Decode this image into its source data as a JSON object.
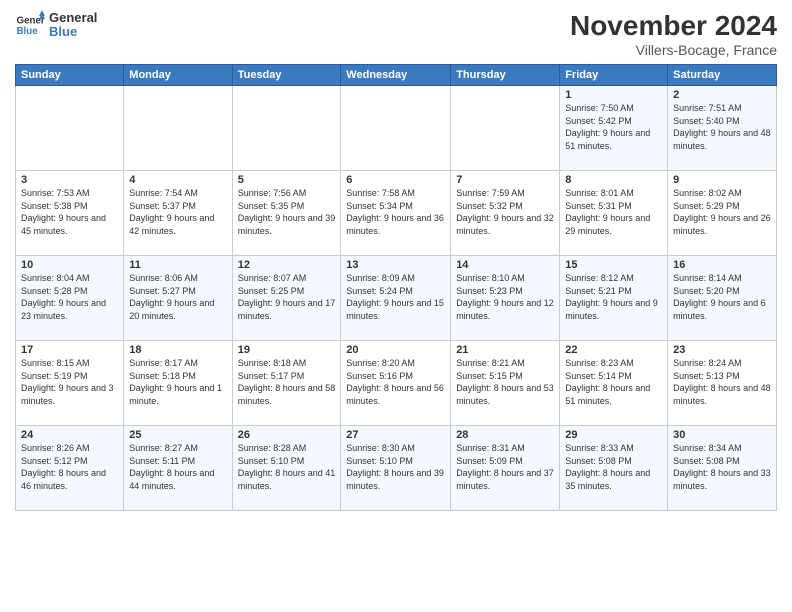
{
  "logo": {
    "general": "General",
    "blue": "Blue"
  },
  "header": {
    "month": "November 2024",
    "location": "Villers-Bocage, France"
  },
  "days_of_week": [
    "Sunday",
    "Monday",
    "Tuesday",
    "Wednesday",
    "Thursday",
    "Friday",
    "Saturday"
  ],
  "weeks": [
    [
      {
        "day": "",
        "info": ""
      },
      {
        "day": "",
        "info": ""
      },
      {
        "day": "",
        "info": ""
      },
      {
        "day": "",
        "info": ""
      },
      {
        "day": "",
        "info": ""
      },
      {
        "day": "1",
        "info": "Sunrise: 7:50 AM\nSunset: 5:42 PM\nDaylight: 9 hours and 51 minutes."
      },
      {
        "day": "2",
        "info": "Sunrise: 7:51 AM\nSunset: 5:40 PM\nDaylight: 9 hours and 48 minutes."
      }
    ],
    [
      {
        "day": "3",
        "info": "Sunrise: 7:53 AM\nSunset: 5:38 PM\nDaylight: 9 hours and 45 minutes."
      },
      {
        "day": "4",
        "info": "Sunrise: 7:54 AM\nSunset: 5:37 PM\nDaylight: 9 hours and 42 minutes."
      },
      {
        "day": "5",
        "info": "Sunrise: 7:56 AM\nSunset: 5:35 PM\nDaylight: 9 hours and 39 minutes."
      },
      {
        "day": "6",
        "info": "Sunrise: 7:58 AM\nSunset: 5:34 PM\nDaylight: 9 hours and 36 minutes."
      },
      {
        "day": "7",
        "info": "Sunrise: 7:59 AM\nSunset: 5:32 PM\nDaylight: 9 hours and 32 minutes."
      },
      {
        "day": "8",
        "info": "Sunrise: 8:01 AM\nSunset: 5:31 PM\nDaylight: 9 hours and 29 minutes."
      },
      {
        "day": "9",
        "info": "Sunrise: 8:02 AM\nSunset: 5:29 PM\nDaylight: 9 hours and 26 minutes."
      }
    ],
    [
      {
        "day": "10",
        "info": "Sunrise: 8:04 AM\nSunset: 5:28 PM\nDaylight: 9 hours and 23 minutes."
      },
      {
        "day": "11",
        "info": "Sunrise: 8:06 AM\nSunset: 5:27 PM\nDaylight: 9 hours and 20 minutes."
      },
      {
        "day": "12",
        "info": "Sunrise: 8:07 AM\nSunset: 5:25 PM\nDaylight: 9 hours and 17 minutes."
      },
      {
        "day": "13",
        "info": "Sunrise: 8:09 AM\nSunset: 5:24 PM\nDaylight: 9 hours and 15 minutes."
      },
      {
        "day": "14",
        "info": "Sunrise: 8:10 AM\nSunset: 5:23 PM\nDaylight: 9 hours and 12 minutes."
      },
      {
        "day": "15",
        "info": "Sunrise: 8:12 AM\nSunset: 5:21 PM\nDaylight: 9 hours and 9 minutes."
      },
      {
        "day": "16",
        "info": "Sunrise: 8:14 AM\nSunset: 5:20 PM\nDaylight: 9 hours and 6 minutes."
      }
    ],
    [
      {
        "day": "17",
        "info": "Sunrise: 8:15 AM\nSunset: 5:19 PM\nDaylight: 9 hours and 3 minutes."
      },
      {
        "day": "18",
        "info": "Sunrise: 8:17 AM\nSunset: 5:18 PM\nDaylight: 9 hours and 1 minute."
      },
      {
        "day": "19",
        "info": "Sunrise: 8:18 AM\nSunset: 5:17 PM\nDaylight: 8 hours and 58 minutes."
      },
      {
        "day": "20",
        "info": "Sunrise: 8:20 AM\nSunset: 5:16 PM\nDaylight: 8 hours and 56 minutes."
      },
      {
        "day": "21",
        "info": "Sunrise: 8:21 AM\nSunset: 5:15 PM\nDaylight: 8 hours and 53 minutes."
      },
      {
        "day": "22",
        "info": "Sunrise: 8:23 AM\nSunset: 5:14 PM\nDaylight: 8 hours and 51 minutes."
      },
      {
        "day": "23",
        "info": "Sunrise: 8:24 AM\nSunset: 5:13 PM\nDaylight: 8 hours and 48 minutes."
      }
    ],
    [
      {
        "day": "24",
        "info": "Sunrise: 8:26 AM\nSunset: 5:12 PM\nDaylight: 8 hours and 46 minutes."
      },
      {
        "day": "25",
        "info": "Sunrise: 8:27 AM\nSunset: 5:11 PM\nDaylight: 8 hours and 44 minutes."
      },
      {
        "day": "26",
        "info": "Sunrise: 8:28 AM\nSunset: 5:10 PM\nDaylight: 8 hours and 41 minutes."
      },
      {
        "day": "27",
        "info": "Sunrise: 8:30 AM\nSunset: 5:10 PM\nDaylight: 8 hours and 39 minutes."
      },
      {
        "day": "28",
        "info": "Sunrise: 8:31 AM\nSunset: 5:09 PM\nDaylight: 8 hours and 37 minutes."
      },
      {
        "day": "29",
        "info": "Sunrise: 8:33 AM\nSunset: 5:08 PM\nDaylight: 8 hours and 35 minutes."
      },
      {
        "day": "30",
        "info": "Sunrise: 8:34 AM\nSunset: 5:08 PM\nDaylight: 8 hours and 33 minutes."
      }
    ]
  ]
}
